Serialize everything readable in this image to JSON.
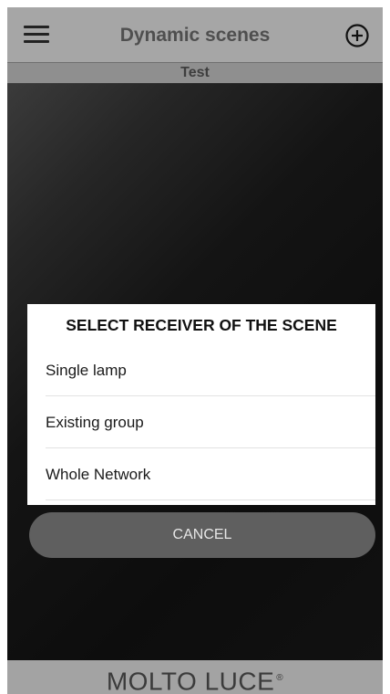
{
  "header": {
    "title": "Dynamic scenes",
    "menu_icon": "hamburger-menu-icon",
    "add_icon": "add-circle-icon"
  },
  "subheader": {
    "label": "Test"
  },
  "dialog": {
    "title": "SELECT RECEIVER OF THE SCENE",
    "options": [
      {
        "label": "Single lamp"
      },
      {
        "label": "Existing group"
      },
      {
        "label": "Whole Network"
      }
    ]
  },
  "cancel": {
    "label": "CANCEL"
  },
  "footer": {
    "brand": "MOLTO LUCE",
    "registered": "®"
  },
  "colors": {
    "header_bg": "#a6a6a6",
    "subheader_bg": "#8f8f8f",
    "main_bg": "#111111",
    "dialog_bg": "#ffffff",
    "cancel_bg": "#5f5f5f",
    "footer_bg": "#a3a3a3"
  }
}
